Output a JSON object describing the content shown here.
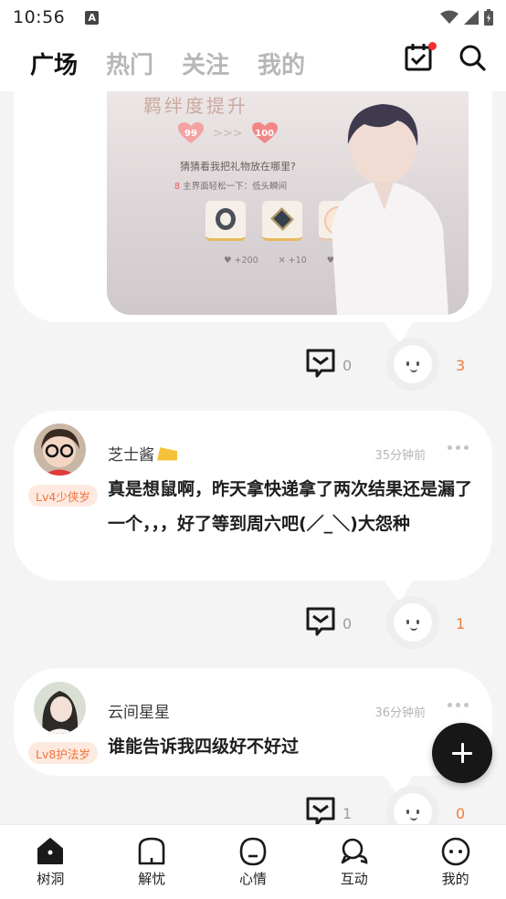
{
  "status_bar": {
    "time": "10:56",
    "notification_icon": "a-notification-icon"
  },
  "top_tabs": [
    {
      "label": "广场",
      "active": true
    },
    {
      "label": "热门",
      "active": false
    },
    {
      "label": "关注",
      "active": false
    },
    {
      "label": "我的",
      "active": false
    }
  ],
  "top_actions": {
    "calendar_icon": "calendar-check-icon",
    "search_icon": "search-icon",
    "badge_color": "#f23030"
  },
  "posts": [
    {
      "image": {
        "banner": "羁绊度提升",
        "heart_from": "99",
        "heart_to": "100",
        "arrows": ">>>",
        "question": "猜猜看我把礼物放在哪里?",
        "hint_num": "8",
        "hint": "主界面轻松一下：低头瞬间",
        "stats": [
          "♥ +200",
          "✕ +10",
          "♥ +5"
        ]
      },
      "comments": "0",
      "reactions": "3"
    },
    {
      "username": "芝士酱",
      "level": "Lv4少侠岁",
      "time": "35分钟前",
      "text": "真是想鼠啊，昨天拿快递拿了两次结果还是漏了一个，，，好了等到周六吧(／_＼)大怨种",
      "comments": "0",
      "reactions": "1"
    },
    {
      "username": "云间星星",
      "level": "Lv8护法岁",
      "time": "36分钟前",
      "text": "谁能告诉我四级好不好过",
      "comments": "1",
      "reactions": "0"
    }
  ],
  "fab_icon": "plus-icon",
  "bottom_nav": [
    {
      "label": "树洞",
      "icon": "tree-hole-icon",
      "active": true
    },
    {
      "label": "解忧",
      "icon": "relief-icon",
      "active": false
    },
    {
      "label": "心情",
      "icon": "mood-icon",
      "active": false
    },
    {
      "label": "互动",
      "icon": "interaction-icon",
      "active": false
    },
    {
      "label": "我的",
      "icon": "profile-icon",
      "active": false
    }
  ],
  "colors": {
    "accent_orange": "#f07c3a",
    "badge_bg": "#fde9df",
    "fab_bg": "#171717"
  }
}
